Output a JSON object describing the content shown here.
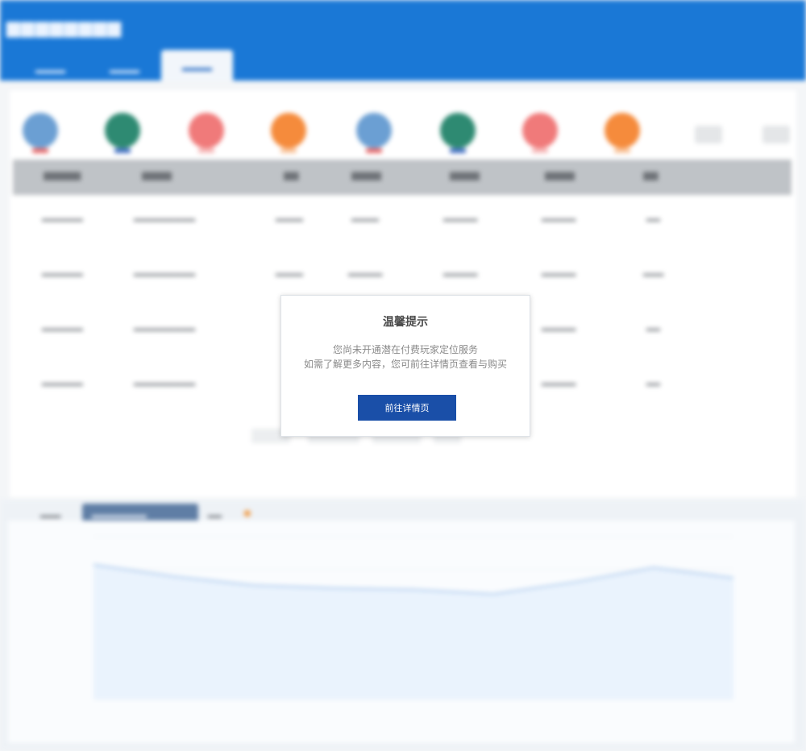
{
  "dialog": {
    "title": "温馨提示",
    "line1": "您尚未开通潜在付费玩家定位服务",
    "line2": "如需了解更多内容，您可前往详情页查看与购买",
    "button_label": "前往详情页"
  },
  "colors": {
    "topbar": "#1a78d6",
    "button": "#1a4fa8",
    "avatars": [
      "#6b9fd3",
      "#2e8a72",
      "#f07a7a",
      "#f58b3c",
      "#6b9fd3",
      "#2e8a72",
      "#f07a7a",
      "#f58b3c"
    ],
    "chart_line": "#aac8ec",
    "chart_fill": "#eaf3fd"
  },
  "chart_series_shape": [
    0.92,
    0.84,
    0.78,
    0.76,
    0.75,
    0.72,
    0.8,
    0.9,
    0.83
  ]
}
